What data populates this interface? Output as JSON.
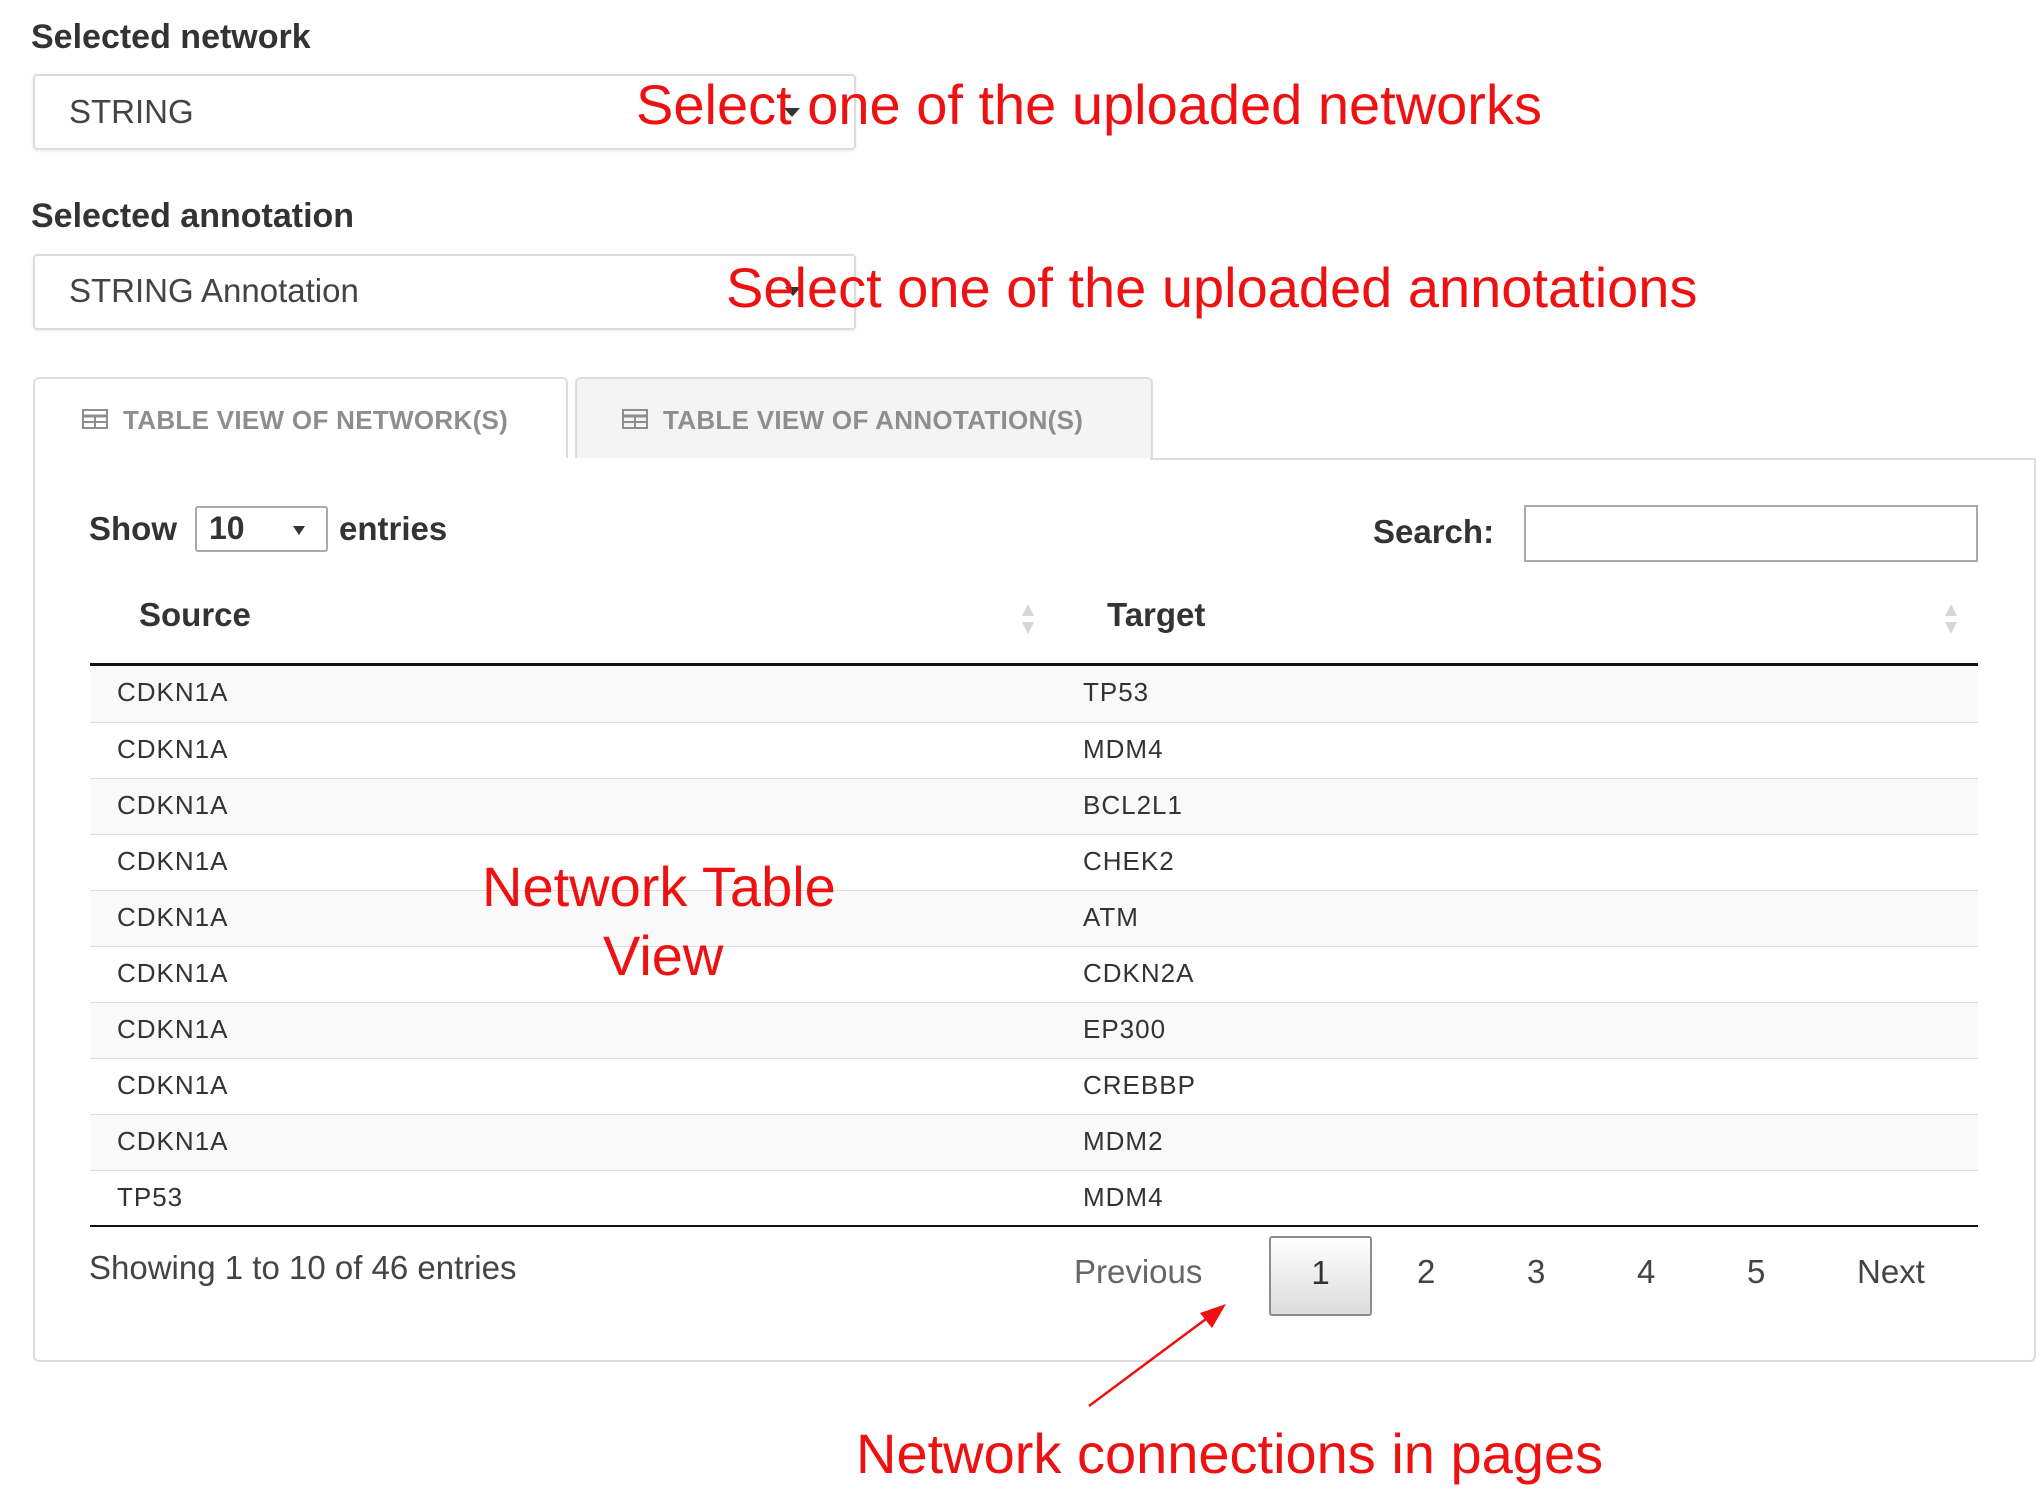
{
  "network_select": {
    "label": "Selected network",
    "value": "STRING"
  },
  "annotation_select": {
    "label": "Selected annotation",
    "value": "STRING Annotation"
  },
  "annotations": {
    "network_hint": "Select one of the uploaded networks",
    "annotation_hint": "Select one of the uploaded annotations",
    "table_hint_line1": "Network Table",
    "table_hint_line2": "View",
    "pagination_hint": "Network connections in pages",
    "color": "#ee1111"
  },
  "tabs": [
    {
      "label": "TABLE VIEW OF NETWORK(S)",
      "icon": "table-icon",
      "active": true
    },
    {
      "label": "TABLE VIEW OF ANNOTATION(S)",
      "icon": "table-icon",
      "active": false
    }
  ],
  "table_controls": {
    "show_label": "Show",
    "page_length": "10",
    "entries_label": "entries",
    "search_label": "Search:",
    "search_value": ""
  },
  "table": {
    "columns": [
      "Source",
      "Target"
    ],
    "rows": [
      [
        "CDKN1A",
        "TP53"
      ],
      [
        "CDKN1A",
        "MDM4"
      ],
      [
        "CDKN1A",
        "BCL2L1"
      ],
      [
        "CDKN1A",
        "CHEK2"
      ],
      [
        "CDKN1A",
        "ATM"
      ],
      [
        "CDKN1A",
        "CDKN2A"
      ],
      [
        "CDKN1A",
        "EP300"
      ],
      [
        "CDKN1A",
        "CREBBP"
      ],
      [
        "CDKN1A",
        "MDM2"
      ],
      [
        "TP53",
        "MDM4"
      ]
    ]
  },
  "footer": {
    "info": "Showing 1 to 10 of 46 entries",
    "previous": "Previous",
    "pages": [
      "1",
      "2",
      "3",
      "4",
      "5"
    ],
    "current_page": "1",
    "next": "Next"
  }
}
